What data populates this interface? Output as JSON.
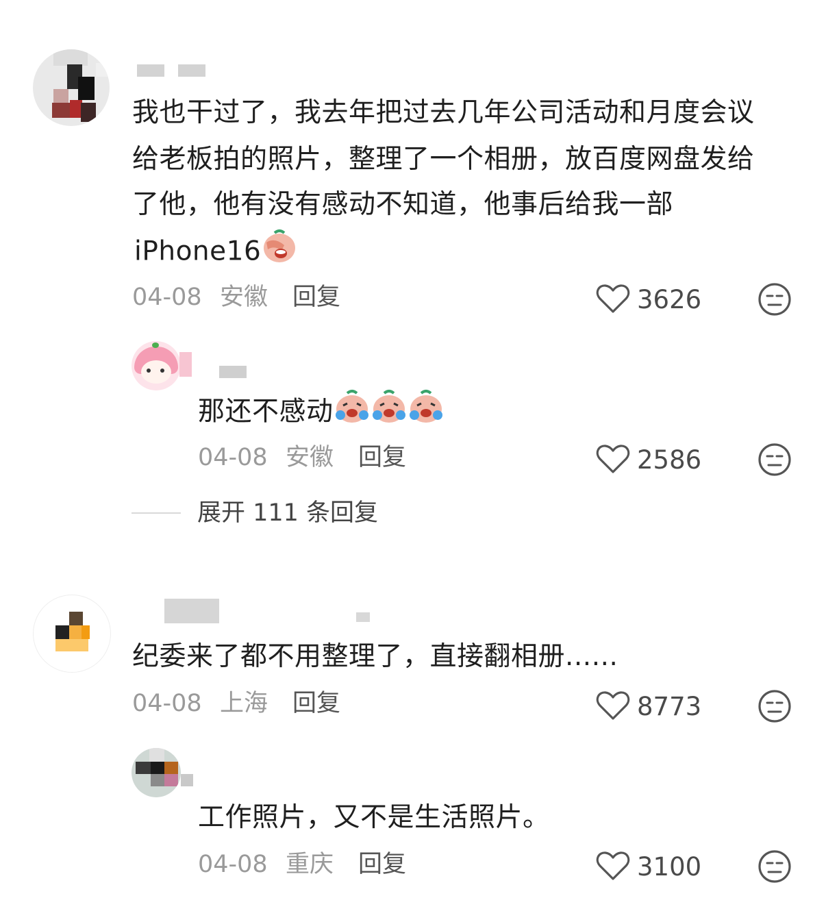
{
  "comments": [
    {
      "text_lines": [
        "我也干过了，我去年把过去几年公司活动和月度会议",
        "给老板拍的照片，整理了一个相册，放百度网盘发给",
        "了他，他有没有感动不知道，他事后给我一部",
        "iPhone16"
      ],
      "date": "04-08",
      "location": "安徽",
      "reply_label": "回复",
      "likes": "3626",
      "replies": [
        {
          "text": "那还不感动",
          "date": "04-08",
          "location": "安徽",
          "reply_label": "回复",
          "likes": "2586"
        }
      ],
      "expand_label": "展开 111 条回复"
    },
    {
      "text_lines": [
        "纪委来了都不用整理了，直接翻相册......"
      ],
      "date": "04-08",
      "location": "上海",
      "reply_label": "回复",
      "likes": "8773",
      "replies": [
        {
          "text": "工作照片，又不是生活照片。",
          "date": "04-08",
          "location": "重庆",
          "reply_label": "回复",
          "likes": "3100"
        }
      ]
    }
  ],
  "icons": {
    "like": "heart-outline-icon",
    "dislike": "meh-face-icon",
    "emoji_facepalm": "facepalm-emoji-icon",
    "emoji_crying": "crying-emoji-icon"
  },
  "colors": {
    "text": "#1f1f1f",
    "meta": "#9a9a9a",
    "icon": "#555555"
  }
}
